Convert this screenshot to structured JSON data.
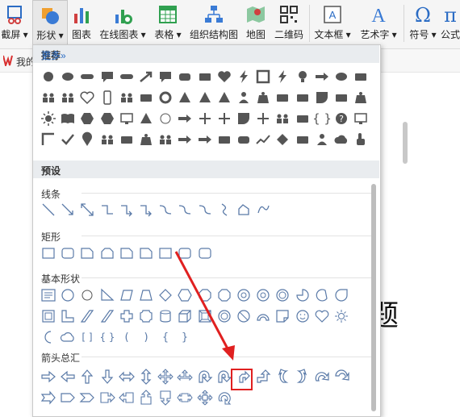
{
  "ribbon": {
    "items": [
      {
        "label": "截屏 ▾",
        "icon": "scissors-icon"
      },
      {
        "label": "形状 ▾",
        "icon": "shapes-icon"
      },
      {
        "label": "图表",
        "icon": "chart-icon"
      },
      {
        "label": "在线图表 ▾",
        "icon": "online-chart-icon"
      },
      {
        "label": "表格 ▾",
        "icon": "table-icon"
      },
      {
        "label": "组织结构图",
        "icon": "org-chart-icon"
      },
      {
        "label": "地图",
        "icon": "map-icon"
      },
      {
        "label": "二维码",
        "icon": "qrcode-icon"
      },
      {
        "label": "文本框 ▾",
        "icon": "textbox-icon"
      },
      {
        "label": "艺术字 ▾",
        "icon": "wordart-icon"
      },
      {
        "label": "符号 ▾",
        "icon": "omega-icon"
      },
      {
        "label": "公式",
        "icon": "pi-icon"
      }
    ],
    "colors": {
      "accent": "#2b6cc4",
      "selected_border": "#e02020"
    }
  },
  "quickbar": {
    "label": "我的"
  },
  "document": {
    "title_fragment": "题"
  },
  "shapes_panel": {
    "recommended_label": "推荐",
    "more_label": "更多»",
    "presets_label": "预设",
    "categories": {
      "lines": "线条",
      "rectangles": "矩形",
      "basic": "基本形状",
      "arrows": "箭头总汇"
    }
  }
}
